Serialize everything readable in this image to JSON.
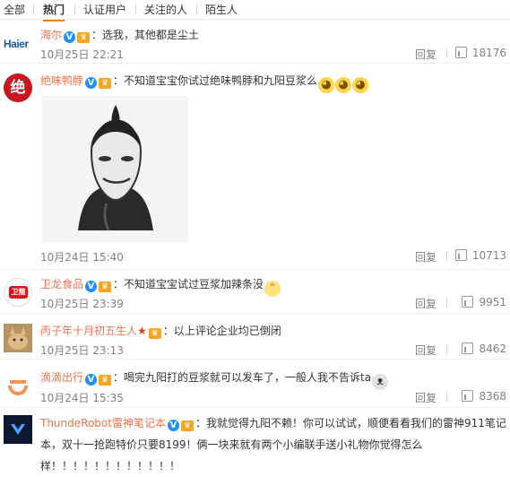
{
  "tabs": [
    "全部",
    "热门",
    "认证用户",
    "关注的人",
    "陌生人"
  ],
  "reply_label": "回复",
  "comments": [
    {
      "user": "海尔",
      "text": "：选我，其他都是尘土",
      "time": "10月25日 22:21",
      "likes": "18176",
      "avatar_text": "Haier"
    },
    {
      "user": "绝味鸭脖",
      "text": "：不知道宝宝你试过绝味鸭脖和九阳豆浆么",
      "time": "10月24日 15:40",
      "likes": "10713",
      "avatar_text": "绝"
    },
    {
      "user": "卫龙食品",
      "text": "：不知道宝宝试过豆浆加辣条没",
      "time": "10月25日 23:39",
      "likes": "9951",
      "avatar_text": "卫龍"
    },
    {
      "user": "丙子年十月初五生人",
      "text": "：以上评论企业均已倒闭",
      "time": "10月25日 23:13",
      "likes": "8462"
    },
    {
      "user": "滴滴出行",
      "text": "：喝完九阳打的豆浆就可以发车了，一般人我不告诉ta",
      "time": "10月24日 15:35",
      "likes": "8368"
    },
    {
      "user": "ThundeRobot雷神笔记本",
      "text": "：我就觉得九阳不赖！你可以试试，顺便看看我们的雷神911笔记",
      "text2": "本，双十一抢跑特价只要8199！俩一块来就有两个小编联手送小礼物你觉得怎么",
      "text3": "样！！！！！！！！！！！！"
    }
  ],
  "icons": {
    "verified": "verified-v-icon",
    "member": "member-crown-icon",
    "like": "thumb-up-icon",
    "emoji": "doge-emoji-icon"
  },
  "colors": {
    "username": "#eb7350",
    "verified": "#1e90ff",
    "active_tab": "#ff8200"
  }
}
